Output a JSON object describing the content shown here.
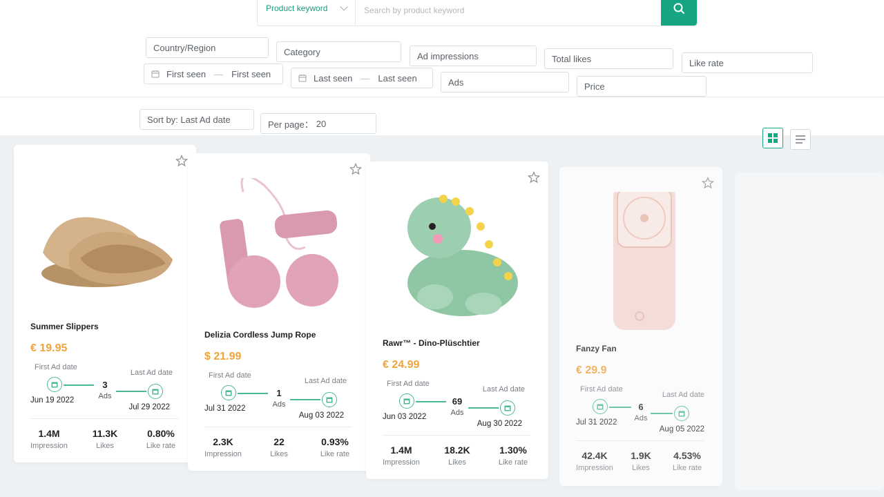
{
  "search": {
    "keyword_type": "Product keyword",
    "placeholder": "Search by product keyword"
  },
  "filters": {
    "country": "Country/Region",
    "category": "Category",
    "ad_impressions": "Ad impressions",
    "total_likes": "Total likes",
    "like_rate": "Like rate",
    "first_seen_start": "First seen",
    "first_seen_end": "First seen",
    "last_seen_start": "Last seen",
    "last_seen_end": "Last seen",
    "ads": "Ads",
    "price": "Price",
    "range_sep": "—"
  },
  "toolbar": {
    "sort_by": "Sort by: Last Ad date",
    "per_page_label": "Per page：",
    "per_page_value": "20"
  },
  "labels": {
    "first_ad_date": "First Ad date",
    "last_ad_date": "Last Ad date",
    "ads": "Ads",
    "impression": "Impression",
    "likes": "Likes",
    "like_rate": "Like rate"
  },
  "products": [
    {
      "name": "Summer Slippers",
      "price": "€ 19.95",
      "first_date": "Jun 19 2022",
      "last_date": "Jul 29 2022",
      "ads": "3",
      "impression": "1.4M",
      "likes": "11.3K",
      "like_rate": "0.80%"
    },
    {
      "name": "Delizia Cordless Jump Rope",
      "price": "$ 21.99",
      "first_date": "Jul 31 2022",
      "last_date": "Aug 03 2022",
      "ads": "1",
      "impression": "2.3K",
      "likes": "22",
      "like_rate": "0.93%"
    },
    {
      "name": "Rawr™ - Dino-Plüschtier",
      "price": "€ 24.99",
      "first_date": "Jun 03 2022",
      "last_date": "Aug 30 2022",
      "ads": "69",
      "impression": "1.4M",
      "likes": "18.2K",
      "like_rate": "1.30%"
    },
    {
      "name": "Fanzy Fan",
      "price": "€ 29.9",
      "first_date": "Jul 31 2022",
      "last_date": "Aug 05 2022",
      "ads": "6",
      "impression": "42.4K",
      "likes": "1.9K",
      "like_rate": "4.53%"
    }
  ],
  "colors": {
    "accent": "#16a583",
    "price": "#f0a33a",
    "timeline": "#4bb89a",
    "content_bg": "#eef1f4"
  },
  "icons": {
    "search": "search-icon",
    "calendar": "calendar-icon",
    "star": "star-icon",
    "grid_view": "grid-view-icon",
    "list_view": "list-view-icon"
  }
}
